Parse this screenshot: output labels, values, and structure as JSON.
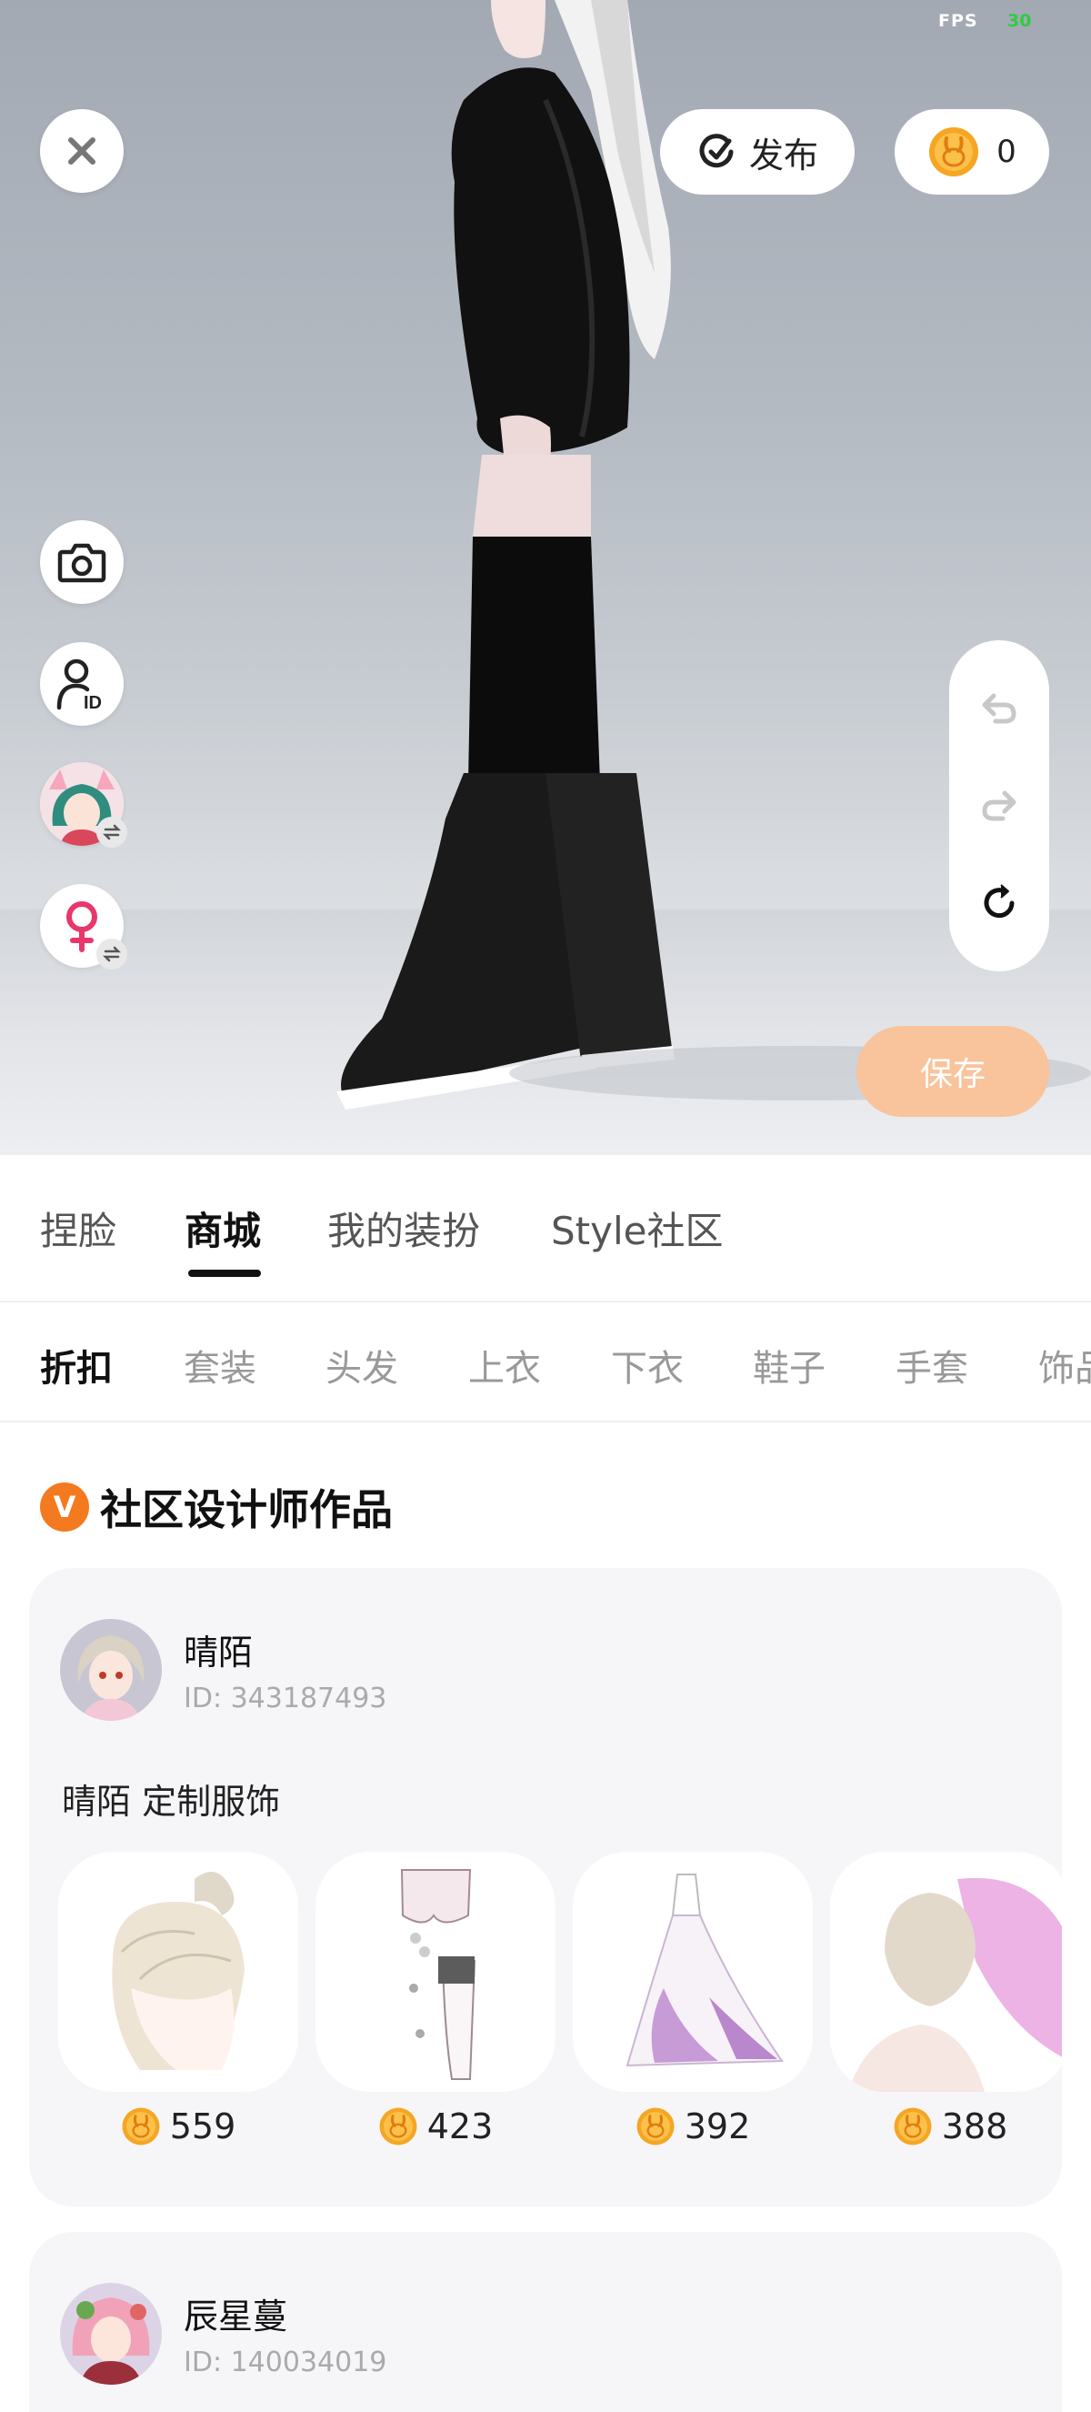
{
  "viewport": {
    "fps_label": "FPS",
    "fps_value": "30",
    "publish_label": "发布",
    "coin_balance": "0",
    "save_label": "保存"
  },
  "main_tabs": [
    {
      "label": "捏脸",
      "active": false
    },
    {
      "label": "商城",
      "active": true
    },
    {
      "label": "我的装扮",
      "active": false
    },
    {
      "label": "Style社区",
      "active": false
    }
  ],
  "categories": [
    {
      "label": "折扣",
      "active": true
    },
    {
      "label": "套装",
      "active": false
    },
    {
      "label": "头发",
      "active": false
    },
    {
      "label": "上衣",
      "active": false
    },
    {
      "label": "下衣",
      "active": false
    },
    {
      "label": "鞋子",
      "active": false
    },
    {
      "label": "手套",
      "active": false
    },
    {
      "label": "饰品",
      "active": false
    }
  ],
  "section": {
    "badge": "V",
    "title": "社区设计师作品"
  },
  "designers": [
    {
      "name": "晴陌",
      "id": "ID: 343187493",
      "description": "晴陌 定制服饰",
      "items": [
        {
          "name": "hair-bun",
          "price": "559"
        },
        {
          "name": "stockings-set",
          "price": "423"
        },
        {
          "name": "wedding-dress",
          "price": "392"
        },
        {
          "name": "updo-hair-with-veil",
          "price": "388"
        }
      ]
    },
    {
      "name": "辰星蔓",
      "id": "ID: 140034019"
    }
  ],
  "colors": {
    "accent": "#f47a1f",
    "save_button": "#f9c39b",
    "card_bg": "#f6f6f9",
    "coin": "#f5a623"
  }
}
